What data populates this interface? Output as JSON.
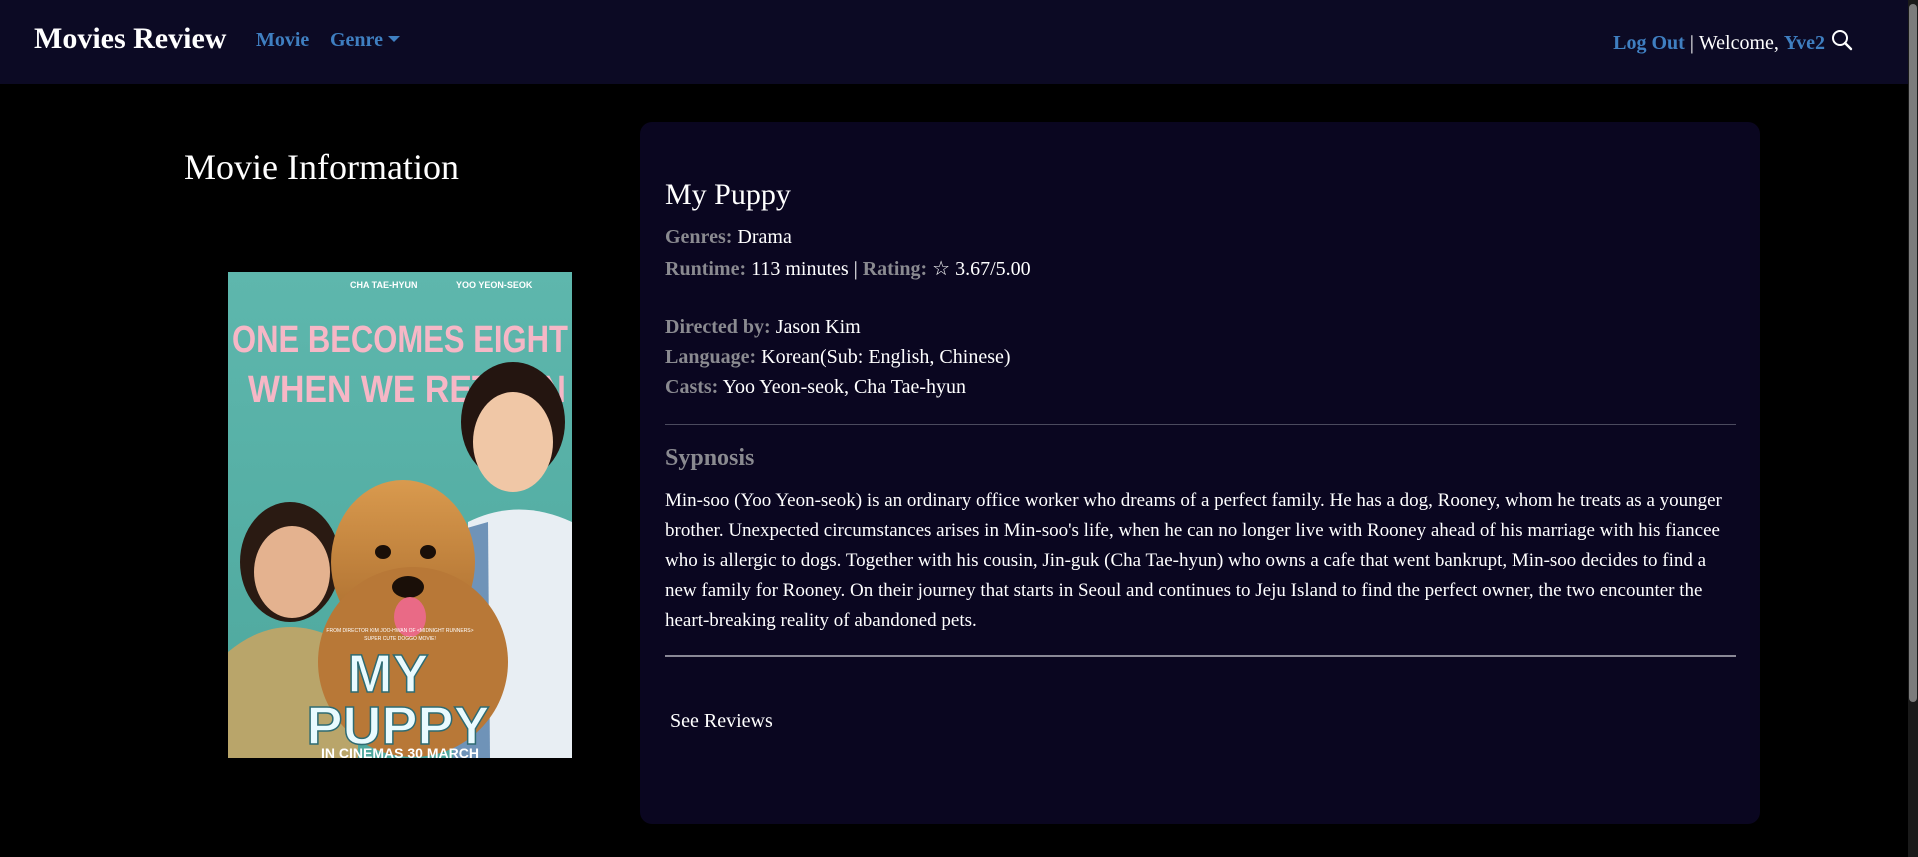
{
  "navbar": {
    "brand": "Movies Review",
    "links": {
      "movie": "Movie",
      "genre": "Genre"
    },
    "logout": "Log Out",
    "separator": "|",
    "welcome": "Welcome,",
    "username": "Yve2"
  },
  "page": {
    "section_title": "Movie Information"
  },
  "poster": {
    "top_names": [
      "CHA TAE-HYUN",
      "YOO YEON-SEOK"
    ],
    "tagline_1": "ONE BECOMES EIGHT",
    "tagline_2": "WHEN WE RETURN",
    "credit_1": "FROM DIRECTOR KIM JOO-HWAN OF <MIDNIGHT RUNNERS>",
    "credit_2": "SUPER CUTE DOGGO MOVIE!",
    "title_1": "MY",
    "title_2": "PUPPY",
    "bottom": "IN CINEMAS 30 MARCH"
  },
  "movie": {
    "title": "My Puppy",
    "genres_label": "Genres:",
    "genres": "Drama",
    "runtime_label": "Runtime:",
    "runtime": "113 minutes",
    "separator": "|",
    "rating_label": "Rating:",
    "rating": "☆ 3.67/5.00",
    "director_label": "Directed by:",
    "director": "Jason Kim",
    "language_label": "Language:",
    "language": "Korean(Sub: English, Chinese)",
    "casts_label": "Casts:",
    "casts": "Yoo Yeon-seok, Cha Tae-hyun",
    "synopsis_heading": "Sypnosis",
    "synopsis": "Min-soo (Yoo Yeon-seok) is an ordinary office worker who dreams of a perfect family. He has a dog, Rooney, whom he treats as a younger brother. Unexpected circumstances arises in Min-soo's life, when he can no longer live with Rooney ahead of his marriage with his fiancee who is allergic to dogs. Together with his cousin, Jin-guk (Cha Tae-hyun) who owns a cafe that went bankrupt, Min-soo decides to find a new family for Rooney. On their journey that starts in Seoul and continues to Jeju Island to find the perfect owner, the two encounter the heart-breaking reality of abandoned pets.",
    "see_reviews": "See Reviews"
  },
  "colors": {
    "navbar_bg": "#0c0a24",
    "link": "#3f7fc1",
    "card_bg": "#0a0620",
    "label": "#8a8a90",
    "poster_bg": "#5bb3a9"
  }
}
